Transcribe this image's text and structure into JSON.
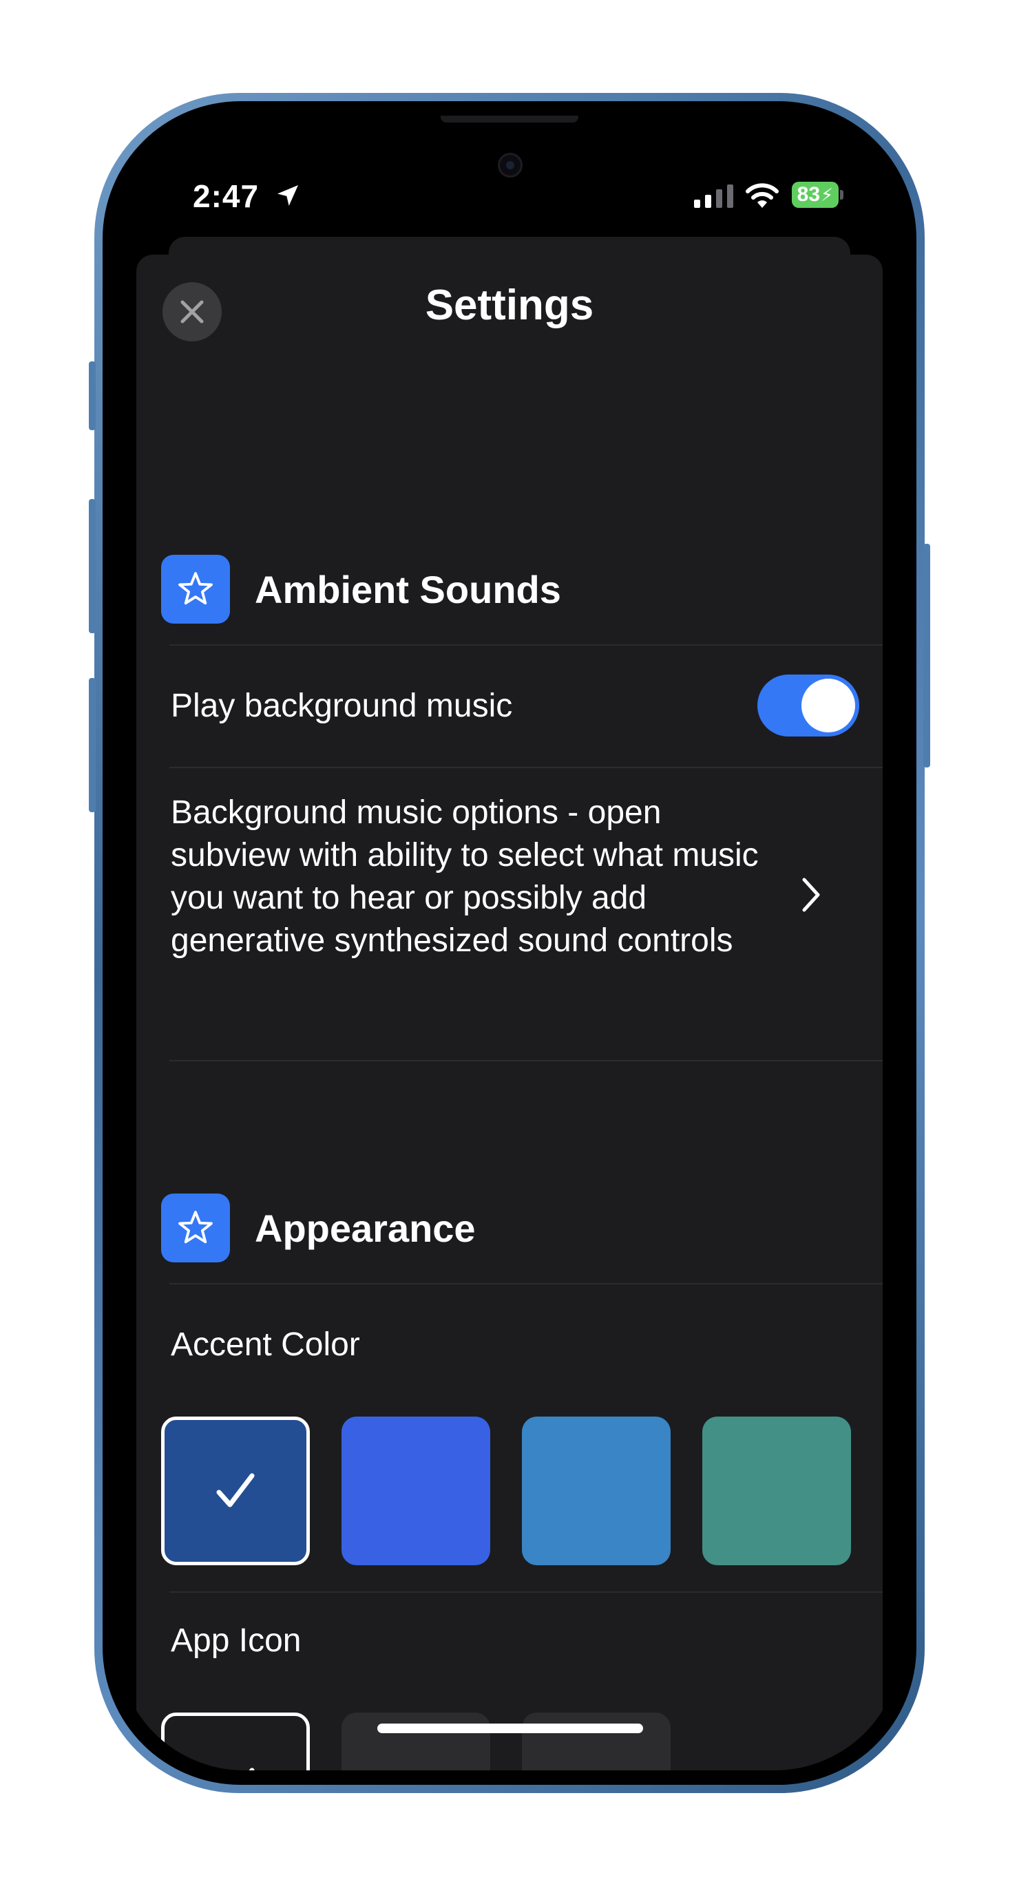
{
  "status_bar": {
    "time": "2:47",
    "battery": "83"
  },
  "sheet": {
    "title": "Settings",
    "close_icon": "close-icon"
  },
  "ambient": {
    "title": "Ambient Sounds",
    "icon": "star-icon",
    "play_music_label": "Play background music",
    "play_music_on": true,
    "options_text": "Background music options - open subview with ability to select what music you want to hear or possibly add generative synthesized sound controls"
  },
  "appearance": {
    "title": "Appearance",
    "icon": "star-icon",
    "accent_label": "Accent Color",
    "accent_colors": [
      "#234e94",
      "#3862e3",
      "#3985c5",
      "#439186"
    ],
    "accent_selected_index": 0,
    "app_icon_label": "App Icon",
    "app_icon_selected_index": 0
  },
  "colors": {
    "accent": "#3478f6",
    "sheet_bg": "#1c1c1e"
  }
}
